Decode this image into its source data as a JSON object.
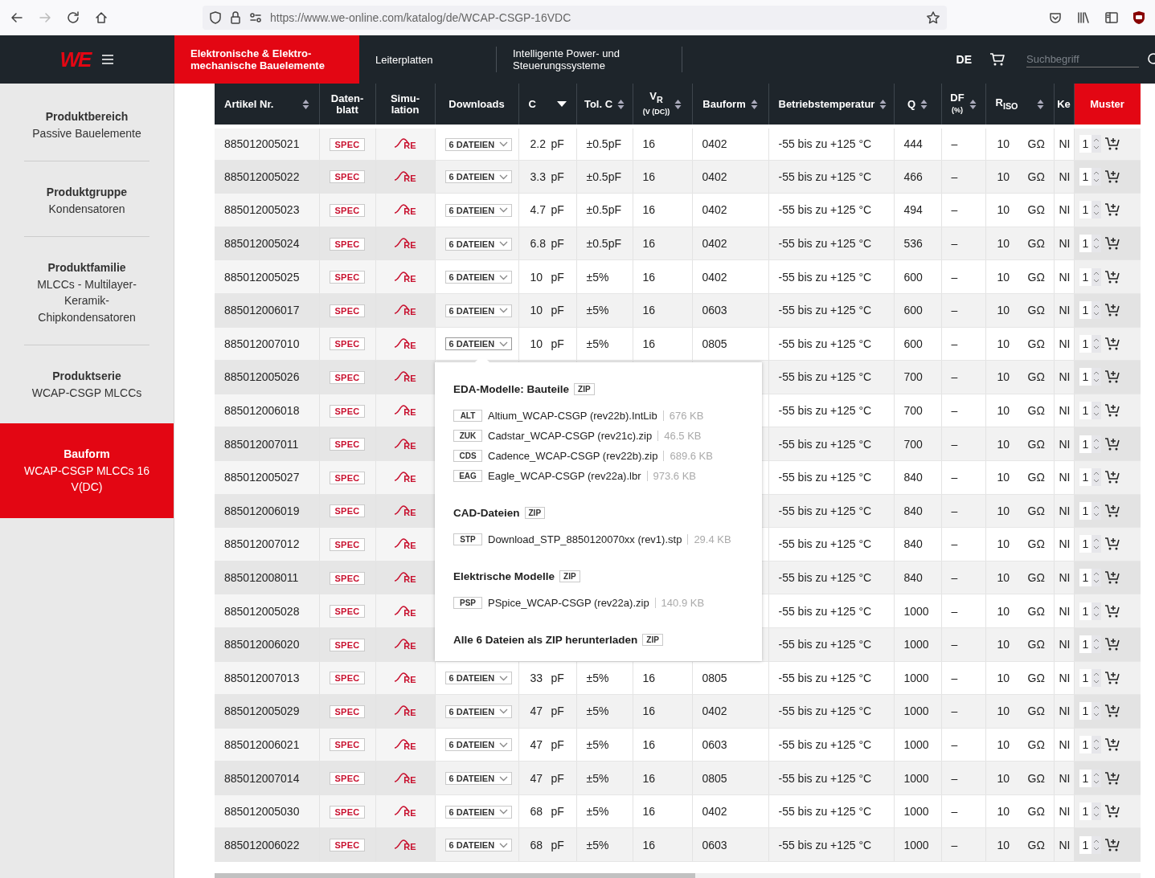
{
  "browser": {
    "url": "https://www.we-online.com/katalog/de/WCAP-CSGP-16VDC",
    "forward_disabled": true
  },
  "navbar": {
    "logo": "WE",
    "items": [
      {
        "label": "Elektronische & Elektro-mechanische Bauelemente",
        "selected": true
      },
      {
        "label": "Leiterplatten",
        "selected": false
      },
      {
        "label": "Intelligente Power- und Steuerungssysteme",
        "selected": false
      }
    ],
    "language": {
      "label": "DE",
      "selected": true
    },
    "search": {
      "placeholder": "Suchbegriff"
    }
  },
  "sidebar": {
    "items": [
      {
        "heading": "Produktbereich",
        "value": "Passive Bauelemente",
        "selected": false
      },
      {
        "heading": "Produktgruppe",
        "value": "Kondensatoren",
        "selected": false
      },
      {
        "heading": "Produktfamilie",
        "value": "MLCCs - Multilayer-Keramik-Chipkondensatoren",
        "selected": false
      },
      {
        "heading": "Produktserie",
        "value": "WCAP-CSGP MLCCs",
        "selected": false
      },
      {
        "heading": "Bauform",
        "value": "WCAP-CSGP MLCCs 16 V(DC)",
        "selected": true
      }
    ]
  },
  "table": {
    "columns": [
      {
        "label": "Artikel Nr.",
        "sortable": true,
        "sorted": false
      },
      {
        "label": "Daten-blatt",
        "sortable": false
      },
      {
        "label": "Simu-lation",
        "sortable": false
      },
      {
        "label": "Downloads",
        "sortable": false
      },
      {
        "label": "C",
        "sortable": true,
        "sorted": true
      },
      {
        "label": "Tol. C",
        "sortable": true,
        "sorted": false
      },
      {
        "label": "V$_{R}$",
        "sub": "(V (DC))",
        "sortable": true,
        "sorted": false
      },
      {
        "label": "Bauform",
        "sortable": true,
        "sorted": false
      },
      {
        "label": "Betriebstemperatur",
        "sortable": true,
        "sorted": false
      },
      {
        "label": "Q",
        "sortable": true,
        "sorted": false
      },
      {
        "label": "DF",
        "sub": "(%)",
        "sortable": true,
        "sorted": false
      },
      {
        "label": "R$_{ISO}$",
        "sortable": true,
        "sorted": false
      },
      {
        "label": "Ke",
        "sortable": false
      },
      {
        "label": "Muster",
        "sortable": false,
        "highlight": true
      }
    ],
    "rows": [
      {
        "article": "885012005021",
        "datasheet": "SPEC",
        "simulation": "RE",
        "downloads": "6 DATEIEN",
        "c_value": "2.2",
        "c_unit": "pF",
        "tolerance": "±0.5pF",
        "vr": "16",
        "bauform": "0402",
        "temperature": "-55 bis zu +125 °C",
        "q": "444",
        "df": "–",
        "riso_value": "10",
        "riso_unit": "GΩ",
        "column_13": "NI",
        "quantity": "1"
      },
      {
        "article": "885012005022",
        "datasheet": "SPEC",
        "simulation": "RE",
        "downloads": "6 DATEIEN",
        "c_value": "3.3",
        "c_unit": "pF",
        "tolerance": "±0.5pF",
        "vr": "16",
        "bauform": "0402",
        "temperature": "-55 bis zu +125 °C",
        "q": "466",
        "df": "–",
        "riso_value": "10",
        "riso_unit": "GΩ",
        "column_13": "NI",
        "quantity": "1"
      },
      {
        "article": "885012005023",
        "datasheet": "SPEC",
        "simulation": "RE",
        "downloads": "6 DATEIEN",
        "c_value": "4.7",
        "c_unit": "pF",
        "tolerance": "±0.5pF",
        "vr": "16",
        "bauform": "0402",
        "temperature": "-55 bis zu +125 °C",
        "q": "494",
        "df": "–",
        "riso_value": "10",
        "riso_unit": "GΩ",
        "column_13": "NI",
        "quantity": "1"
      },
      {
        "article": "885012005024",
        "datasheet": "SPEC",
        "simulation": "RE",
        "downloads": "6 DATEIEN",
        "c_value": "6.8",
        "c_unit": "pF",
        "tolerance": "±0.5pF",
        "vr": "16",
        "bauform": "0402",
        "temperature": "-55 bis zu +125 °C",
        "q": "536",
        "df": "–",
        "riso_value": "10",
        "riso_unit": "GΩ",
        "column_13": "NI",
        "quantity": "1"
      },
      {
        "article": "885012005025",
        "datasheet": "SPEC",
        "simulation": "RE",
        "downloads": "6 DATEIEN",
        "c_value": "10",
        "c_unit": "pF",
        "tolerance": "±5%",
        "vr": "16",
        "bauform": "0402",
        "temperature": "-55 bis zu +125 °C",
        "q": "600",
        "df": "–",
        "riso_value": "10",
        "riso_unit": "GΩ",
        "column_13": "NI",
        "quantity": "1"
      },
      {
        "article": "885012006017",
        "datasheet": "SPEC",
        "simulation": "RE",
        "downloads": "6 DATEIEN",
        "c_value": "10",
        "c_unit": "pF",
        "tolerance": "±5%",
        "vr": "16",
        "bauform": "0603",
        "temperature": "-55 bis zu +125 °C",
        "q": "600",
        "df": "–",
        "riso_value": "10",
        "riso_unit": "GΩ",
        "column_13": "NI",
        "quantity": "1"
      },
      {
        "article": "885012007010",
        "datasheet": "SPEC",
        "simulation": "RE",
        "downloads": "6 DATEIEN",
        "c_value": "10",
        "c_unit": "pF",
        "tolerance": "±5%",
        "vr": "16",
        "bauform": "0805",
        "temperature": "-55 bis zu +125 °C",
        "q": "600",
        "df": "–",
        "riso_value": "10",
        "riso_unit": "GΩ",
        "column_13": "NI",
        "quantity": "1",
        "expanded": true
      },
      {
        "article": "885012005026",
        "datasheet": "SPEC",
        "simulation": "RE",
        "temperature": "-55 bis zu +125 °C",
        "q": "700",
        "df": "–",
        "riso_value": "10",
        "riso_unit": "GΩ",
        "column_13": "NI",
        "quantity": "1"
      },
      {
        "article": "885012006018",
        "datasheet": "SPEC",
        "simulation": "RE",
        "temperature": "-55 bis zu +125 °C",
        "q": "700",
        "df": "–",
        "riso_value": "10",
        "riso_unit": "GΩ",
        "column_13": "NI",
        "quantity": "1"
      },
      {
        "article": "885012007011",
        "datasheet": "SPEC",
        "simulation": "RE",
        "temperature": "-55 bis zu +125 °C",
        "q": "700",
        "df": "–",
        "riso_value": "10",
        "riso_unit": "GΩ",
        "column_13": "NI",
        "quantity": "1"
      },
      {
        "article": "885012005027",
        "datasheet": "SPEC",
        "simulation": "RE",
        "temperature": "-55 bis zu +125 °C",
        "q": "840",
        "df": "–",
        "riso_value": "10",
        "riso_unit": "GΩ",
        "column_13": "NI",
        "quantity": "1"
      },
      {
        "article": "885012006019",
        "datasheet": "SPEC",
        "simulation": "RE",
        "temperature": "-55 bis zu +125 °C",
        "q": "840",
        "df": "–",
        "riso_value": "10",
        "riso_unit": "GΩ",
        "column_13": "NI",
        "quantity": "1"
      },
      {
        "article": "885012007012",
        "datasheet": "SPEC",
        "simulation": "RE",
        "temperature": "-55 bis zu +125 °C",
        "q": "840",
        "df": "–",
        "riso_value": "10",
        "riso_unit": "GΩ",
        "column_13": "NI",
        "quantity": "1"
      },
      {
        "article": "885012008011",
        "datasheet": "SPEC",
        "simulation": "RE",
        "temperature": "-55 bis zu +125 °C",
        "q": "840",
        "df": "–",
        "riso_value": "10",
        "riso_unit": "GΩ",
        "column_13": "NI",
        "quantity": "1"
      },
      {
        "article": "885012005028",
        "datasheet": "SPEC",
        "simulation": "RE",
        "temperature": "-55 bis zu +125 °C",
        "q": "1000",
        "df": "–",
        "riso_value": "10",
        "riso_unit": "GΩ",
        "column_13": "NI",
        "quantity": "1"
      },
      {
        "article": "885012006020",
        "datasheet": "SPEC",
        "simulation": "RE",
        "temperature": "-55 bis zu +125 °C",
        "q": "1000",
        "df": "–",
        "riso_value": "10",
        "riso_unit": "GΩ",
        "column_13": "NI",
        "quantity": "1"
      },
      {
        "article": "885012007013",
        "datasheet": "SPEC",
        "simulation": "RE",
        "downloads": "6 DATEIEN",
        "c_value": "33",
        "c_unit": "pF",
        "tolerance": "±5%",
        "vr": "16",
        "bauform": "0805",
        "temperature": "-55 bis zu +125 °C",
        "q": "1000",
        "df": "–",
        "riso_value": "10",
        "riso_unit": "GΩ",
        "column_13": "NI",
        "quantity": "1"
      },
      {
        "article": "885012005029",
        "datasheet": "SPEC",
        "simulation": "RE",
        "downloads": "6 DATEIEN",
        "c_value": "47",
        "c_unit": "pF",
        "tolerance": "±5%",
        "vr": "16",
        "bauform": "0402",
        "temperature": "-55 bis zu +125 °C",
        "q": "1000",
        "df": "–",
        "riso_value": "10",
        "riso_unit": "GΩ",
        "column_13": "NI",
        "quantity": "1"
      },
      {
        "article": "885012006021",
        "datasheet": "SPEC",
        "simulation": "RE",
        "downloads": "6 DATEIEN",
        "c_value": "47",
        "c_unit": "pF",
        "tolerance": "±5%",
        "vr": "16",
        "bauform": "0603",
        "temperature": "-55 bis zu +125 °C",
        "q": "1000",
        "df": "–",
        "riso_value": "10",
        "riso_unit": "GΩ",
        "column_13": "NI",
        "quantity": "1"
      },
      {
        "article": "885012007014",
        "datasheet": "SPEC",
        "simulation": "RE",
        "downloads": "6 DATEIEN",
        "c_value": "47",
        "c_unit": "pF",
        "tolerance": "±5%",
        "vr": "16",
        "bauform": "0805",
        "temperature": "-55 bis zu +125 °C",
        "q": "1000",
        "df": "–",
        "riso_value": "10",
        "riso_unit": "GΩ",
        "column_13": "NI",
        "quantity": "1"
      },
      {
        "article": "885012005030",
        "datasheet": "SPEC",
        "simulation": "RE",
        "downloads": "6 DATEIEN",
        "c_value": "68",
        "c_unit": "pF",
        "tolerance": "±5%",
        "vr": "16",
        "bauform": "0402",
        "temperature": "-55 bis zu +125 °C",
        "q": "1000",
        "df": "–",
        "riso_value": "10",
        "riso_unit": "GΩ",
        "column_13": "NI",
        "quantity": "1"
      },
      {
        "article": "885012006022",
        "datasheet": "SPEC",
        "simulation": "RE",
        "downloads": "6 DATEIEN",
        "c_value": "68",
        "c_unit": "pF",
        "tolerance": "±5%",
        "vr": "16",
        "bauform": "0603",
        "temperature": "-55 bis zu +125 °C",
        "q": "1000",
        "df": "–",
        "riso_value": "10",
        "riso_unit": "GΩ",
        "column_13": "NI",
        "quantity": "1"
      }
    ]
  },
  "downloads_popup": {
    "groups": [
      {
        "title": "EDA-Modelle: Bauteile",
        "zip": "ZIP",
        "files": [
          {
            "tag": "ALT",
            "name": "Altium_WCAP-CSGP (rev22b).IntLib",
            "size": "676 KB"
          },
          {
            "tag": "ZUK",
            "name": "Cadstar_WCAP-CSGP (rev21c).zip",
            "size": "46.5 KB"
          },
          {
            "tag": "CDS",
            "name": "Cadence_WCAP-CSGP (rev22b).zip",
            "size": "689.6 KB"
          },
          {
            "tag": "EAG",
            "name": "Eagle_WCAP-CSGP (rev22a).lbr",
            "size": "973.6 KB"
          }
        ]
      },
      {
        "title": "CAD-Dateien",
        "zip": "ZIP",
        "files": [
          {
            "tag": "STP",
            "name": "Download_STP_8850120070xx (rev1).stp",
            "size": "29.4 KB"
          }
        ]
      },
      {
        "title": "Elektrische Modelle",
        "zip": "ZIP",
        "files": [
          {
            "tag": "PSP",
            "name": "PSpice_WCAP-CSGP (rev22a).zip",
            "size": "140.9 KB"
          }
        ]
      }
    ],
    "all": {
      "label": "Alle 6 Dateien als ZIP herunterladen",
      "zip": "ZIP"
    }
  }
}
